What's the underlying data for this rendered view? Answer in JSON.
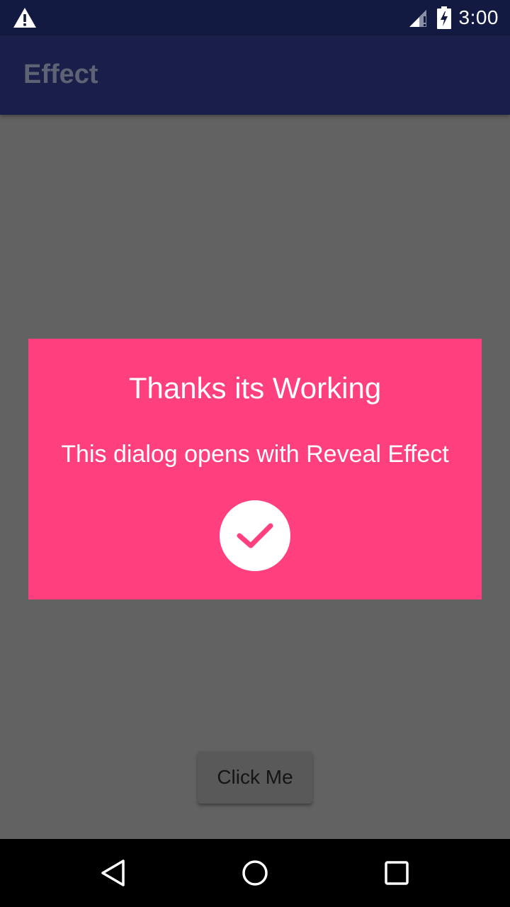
{
  "status_bar": {
    "warning_icon": "warning-icon",
    "signal_icon": "signal-icon",
    "battery_icon": "battery-charging-icon",
    "time": "3:00"
  },
  "app_bar": {
    "title": "Effect"
  },
  "dialog": {
    "title": "Thanks its Working",
    "message": "This dialog opens with Reveal Effect",
    "confirm_icon": "checkmark-icon",
    "background_color": "#ff3f7e"
  },
  "main": {
    "button_label": "Click Me"
  },
  "nav_bar": {
    "back_icon": "back-icon",
    "home_icon": "home-icon",
    "recents_icon": "recents-icon"
  },
  "colors": {
    "status_bar": "#121a42",
    "app_bar": "#1a1f4a",
    "scrim_background": "#626262",
    "accent": "#ff3f7e"
  }
}
